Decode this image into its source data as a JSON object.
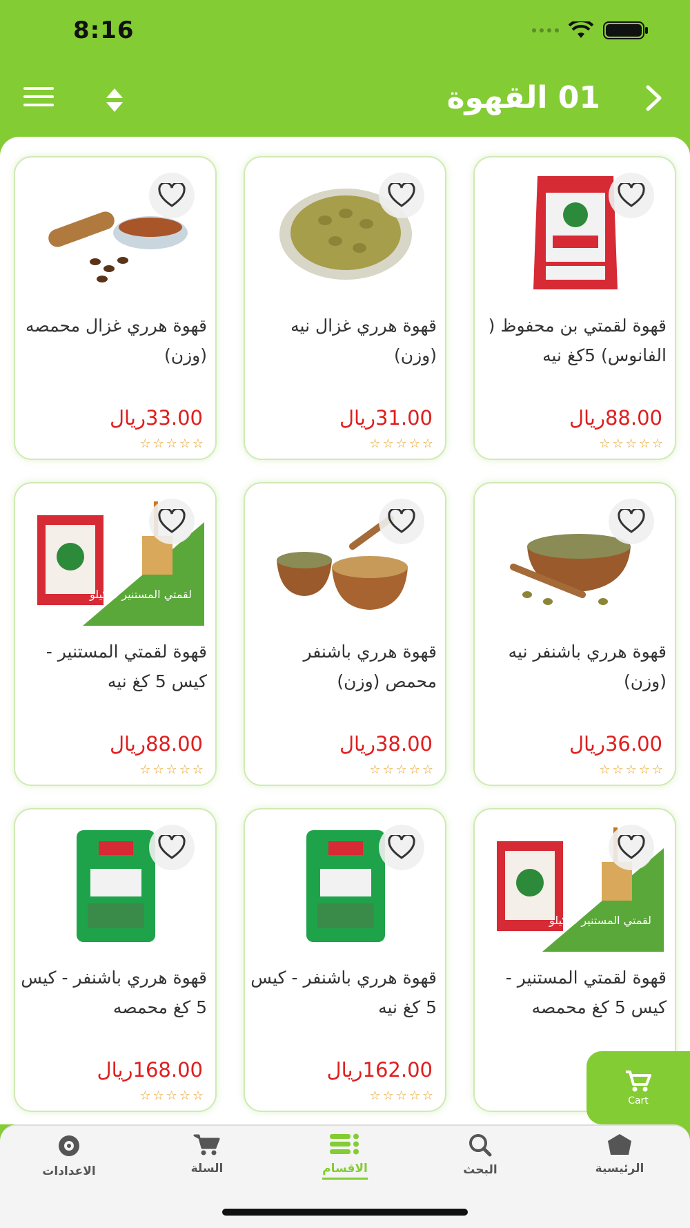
{
  "status": {
    "time": "8:16"
  },
  "header": {
    "title": "01 القهوة"
  },
  "products": [
    {
      "name": "قهوة لقمتي بن محفوظ ( الفانوس) 5كغ نيه",
      "price": "88.00ريال",
      "image": "rice-bag-icon"
    },
    {
      "name": "قهوة هرري غزال نيه (وزن)",
      "price": "31.00ريال",
      "image": "coffee-beans-icon"
    },
    {
      "name": "قهوة هرري غزال محمصه (وزن)",
      "price": "33.00ريال",
      "image": "ground-coffee-icon"
    },
    {
      "name": "قهوة هرري باشنفر نيه (وزن)",
      "price": "36.00ريال",
      "image": "coffee-bowl-icon"
    },
    {
      "name": "قهوة هرري باشنفر محمص (وزن)",
      "price": "38.00ريال",
      "image": "coffee-powder-icon"
    },
    {
      "name": "قهوة لقمتي المستنير - كيس 5 كغ نيه",
      "price": "88.00ريال",
      "image": "product-bag-icon",
      "banner": "لقمتي المستنير 5 كيلو"
    },
    {
      "name": "قهوة لقمتي المستنير - كيس 5 كغ محمصه",
      "price": "",
      "image": "product-bag-icon",
      "banner": "لقمتي المستنير 5 كيلو"
    },
    {
      "name": "قهوة هرري باشنفر - كيس 5 كغ نيه",
      "price": "162.00ريال",
      "image": "green-bag-icon"
    },
    {
      "name": "قهوة هرري باشنفر - كيس 5 كغ محمصه",
      "price": "168.00ريال",
      "image": "green-bag-icon"
    }
  ],
  "stars": "☆☆☆☆☆",
  "cart_fab": {
    "label": "Cart"
  },
  "tabs": [
    {
      "label": "الرئيسية",
      "icon": "home-icon"
    },
    {
      "label": "البحث",
      "icon": "search-icon"
    },
    {
      "label": "الاقسام",
      "icon": "categories-icon",
      "active": true
    },
    {
      "label": "السلة",
      "icon": "cart-icon"
    },
    {
      "label": "الاعدادات",
      "icon": "settings-icon"
    }
  ],
  "colors": {
    "brand": "#84cc34",
    "price": "#e01e1e",
    "star": "#e8a326"
  }
}
